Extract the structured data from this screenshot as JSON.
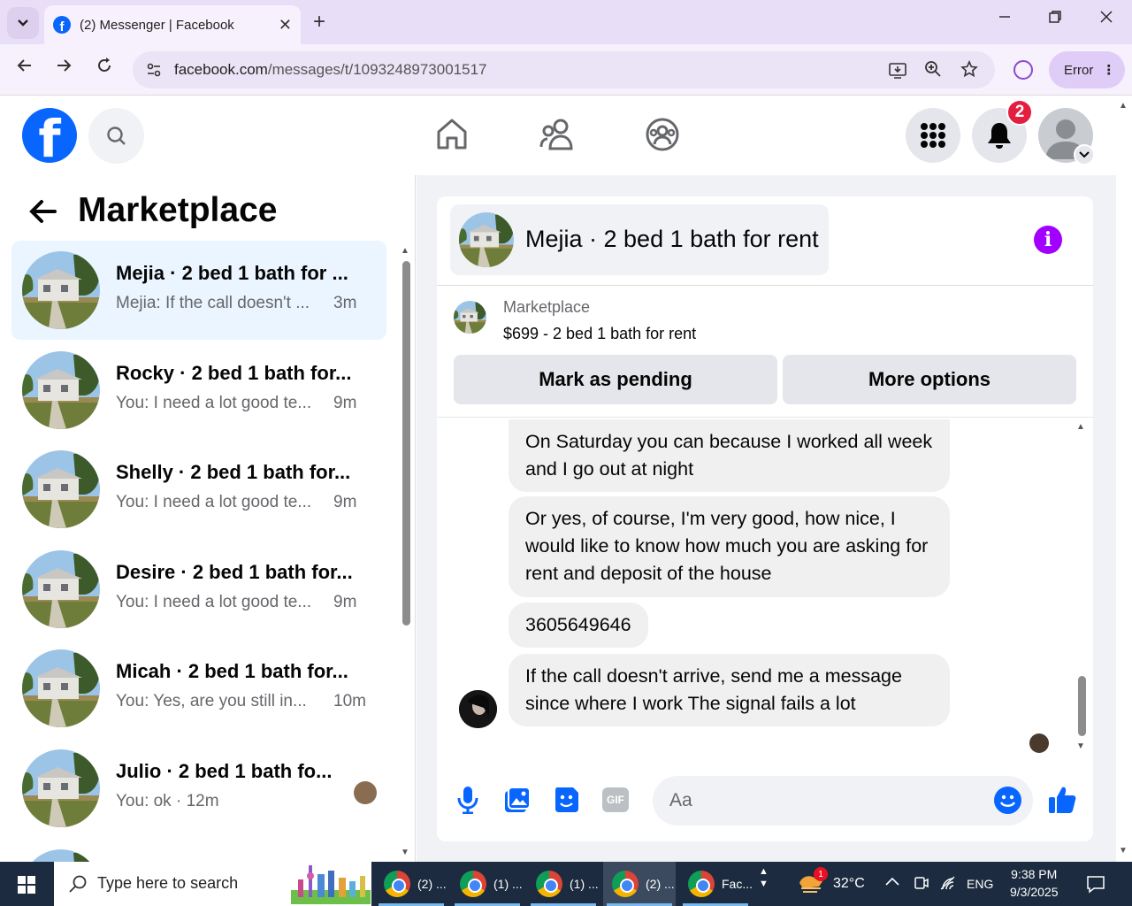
{
  "browser": {
    "tab_title": "(2) Messenger | Facebook",
    "url_domain": "facebook.com",
    "url_path": "/messages/t/1093248973001517",
    "error_label": "Error"
  },
  "fb": {
    "notification_count": "2",
    "brand_color": "#0866ff"
  },
  "sidebar": {
    "title": "Marketplace",
    "conversations": [
      {
        "name": "Mejia · 2 bed 1 bath for ...",
        "preview": "Mejia: If the call doesn't ...",
        "time": "3m"
      },
      {
        "name": "Rocky · 2 bed 1 bath for...",
        "preview": "You: I need a lot good te...",
        "time": "9m"
      },
      {
        "name": "Shelly · 2 bed 1 bath for...",
        "preview": "You: I need a lot good te...",
        "time": "9m"
      },
      {
        "name": "Desire · 2 bed 1 bath for...",
        "preview": "You: I need a lot good te...",
        "time": "9m"
      },
      {
        "name": "Micah · 2 bed 1 bath for...",
        "preview": "You: Yes, are you still in...",
        "time": "10m"
      },
      {
        "name": "Julio · 2 bed 1 bath fo...",
        "preview": "You: ok · 12m",
        "time": ""
      }
    ]
  },
  "chat": {
    "title": "Mejia · 2 bed 1 bath for rent",
    "listing_label": "Marketplace",
    "listing_price": "$699 - 2 bed 1 bath for rent",
    "mark_pending_label": "Mark as pending",
    "more_options_label": "More options",
    "messages": [
      "On Saturday you can because I worked all week and I go out at night",
      "Or yes, of course, I'm very good, how nice, I would like to know how much you are asking for rent and deposit of the house",
      "3605649646",
      "If the call doesn't arrive, send me a message since where I work The signal fails a lot"
    ],
    "composer_placeholder": "Aa",
    "gif_label": "GIF"
  },
  "taskbar": {
    "search_placeholder": "Type here to search",
    "apps": [
      {
        "label": "(2) ..."
      },
      {
        "label": "(1) ..."
      },
      {
        "label": "(1) ..."
      },
      {
        "label": "(2) ..."
      },
      {
        "label": "Fac..."
      }
    ],
    "weather_badge": "1",
    "temperature": "32°C",
    "language": "ENG",
    "time": "9:38 PM",
    "date": "9/3/2025"
  }
}
